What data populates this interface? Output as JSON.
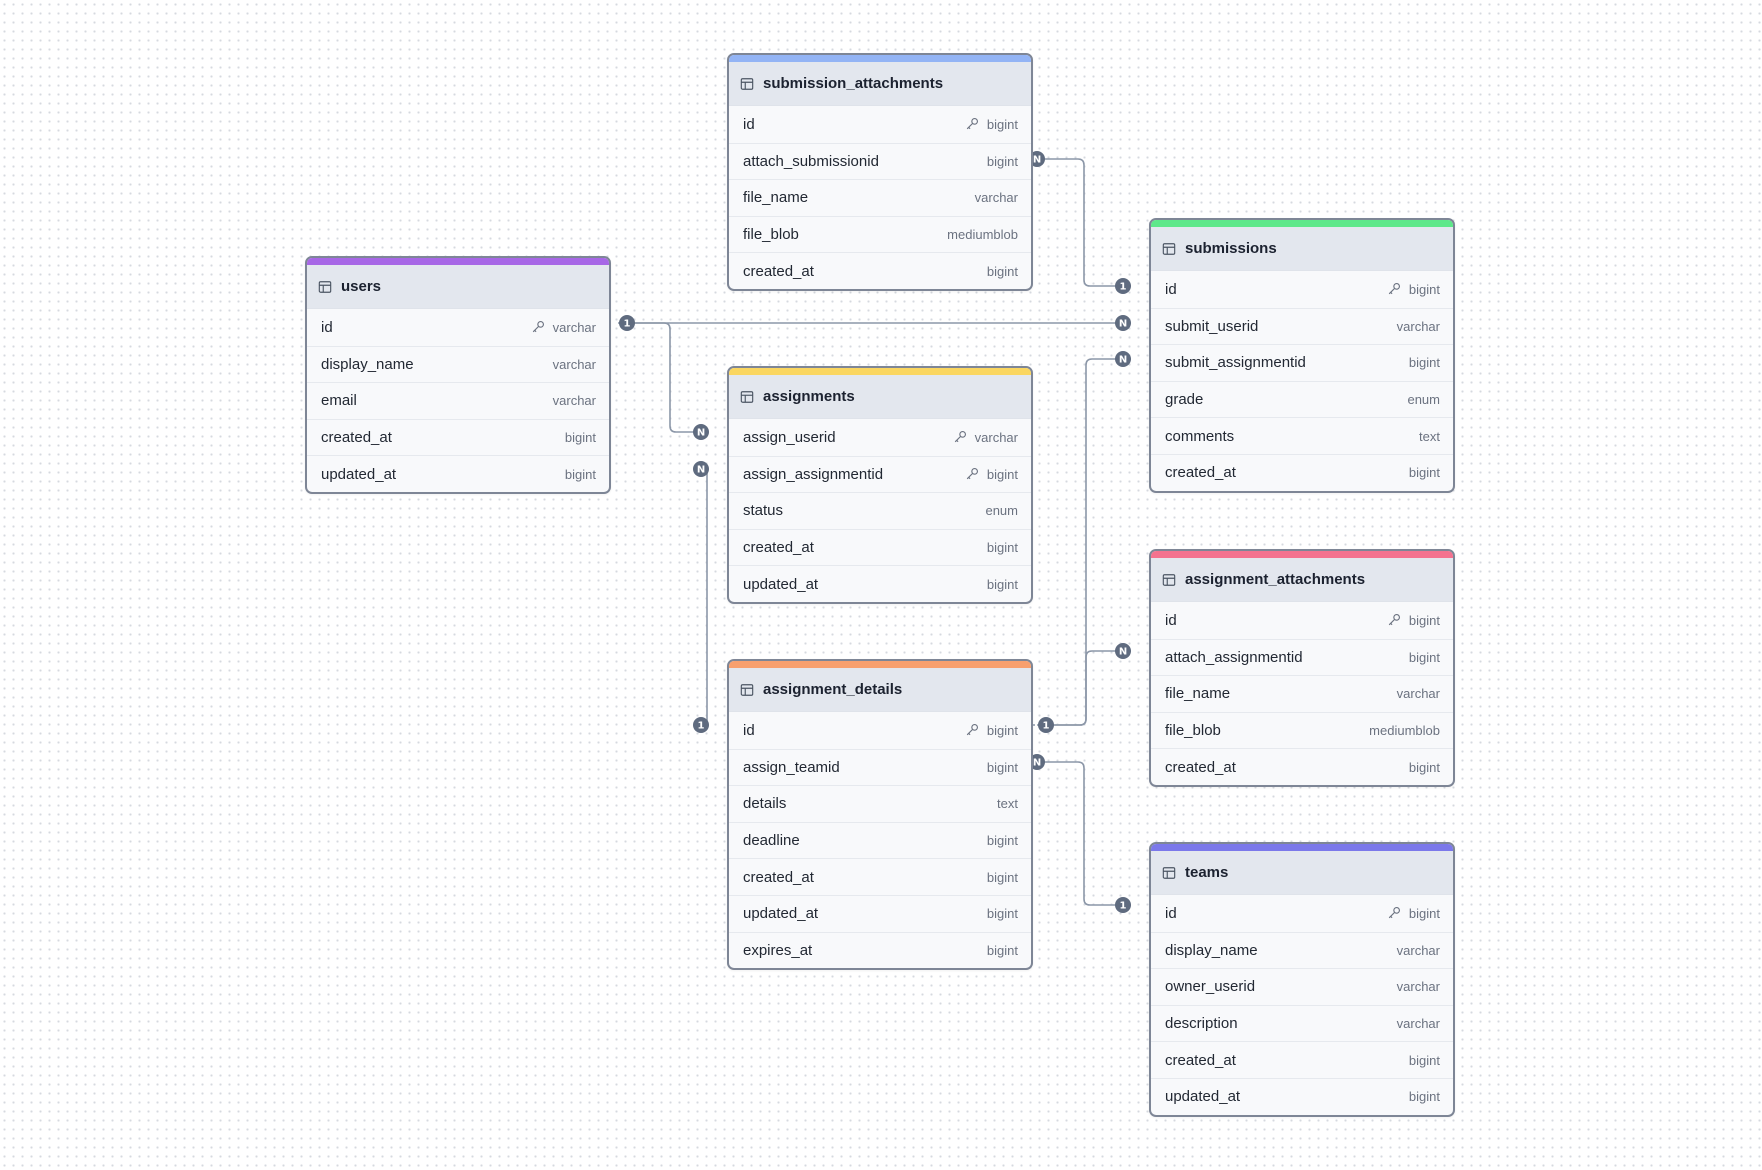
{
  "tables": [
    {
      "id": "submission_attachments",
      "name": "submission_attachments",
      "accent": "#93b4f5",
      "columns": [
        {
          "name": "id",
          "type": "bigint",
          "pk": true
        },
        {
          "name": "attach_submissionid",
          "type": "bigint"
        },
        {
          "name": "file_name",
          "type": "varchar"
        },
        {
          "name": "file_blob",
          "type": "mediumblob"
        },
        {
          "name": "created_at",
          "type": "bigint"
        }
      ]
    },
    {
      "id": "users",
      "name": "users",
      "accent": "#a767e6",
      "columns": [
        {
          "name": "id",
          "type": "varchar",
          "pk": true
        },
        {
          "name": "display_name",
          "type": "varchar"
        },
        {
          "name": "email",
          "type": "varchar"
        },
        {
          "name": "created_at",
          "type": "bigint"
        },
        {
          "name": "updated_at",
          "type": "bigint"
        }
      ]
    },
    {
      "id": "submissions",
      "name": "submissions",
      "accent": "#5ee88a",
      "columns": [
        {
          "name": "id",
          "type": "bigint",
          "pk": true
        },
        {
          "name": "submit_userid",
          "type": "varchar"
        },
        {
          "name": "submit_assignmentid",
          "type": "bigint"
        },
        {
          "name": "grade",
          "type": "enum"
        },
        {
          "name": "comments",
          "type": "text"
        },
        {
          "name": "created_at",
          "type": "bigint"
        }
      ]
    },
    {
      "id": "assignments",
      "name": "assignments",
      "accent": "#fad660",
      "columns": [
        {
          "name": "assign_userid",
          "type": "varchar",
          "pk": true
        },
        {
          "name": "assign_assignmentid",
          "type": "bigint",
          "pk": true
        },
        {
          "name": "status",
          "type": "enum"
        },
        {
          "name": "created_at",
          "type": "bigint"
        },
        {
          "name": "updated_at",
          "type": "bigint"
        }
      ]
    },
    {
      "id": "assignment_attachments",
      "name": "assignment_attachments",
      "accent": "#f4728f",
      "columns": [
        {
          "name": "id",
          "type": "bigint",
          "pk": true
        },
        {
          "name": "attach_assignmentid",
          "type": "bigint"
        },
        {
          "name": "file_name",
          "type": "varchar"
        },
        {
          "name": "file_blob",
          "type": "mediumblob"
        },
        {
          "name": "created_at",
          "type": "bigint"
        }
      ]
    },
    {
      "id": "assignment_details",
      "name": "assignment_details",
      "accent": "#f8a06e",
      "columns": [
        {
          "name": "id",
          "type": "bigint",
          "pk": true
        },
        {
          "name": "assign_teamid",
          "type": "bigint"
        },
        {
          "name": "details",
          "type": "text"
        },
        {
          "name": "deadline",
          "type": "bigint"
        },
        {
          "name": "created_at",
          "type": "bigint"
        },
        {
          "name": "updated_at",
          "type": "bigint"
        },
        {
          "name": "expires_at",
          "type": "bigint"
        }
      ]
    },
    {
      "id": "teams",
      "name": "teams",
      "accent": "#7b78ea",
      "columns": [
        {
          "name": "id",
          "type": "bigint",
          "pk": true
        },
        {
          "name": "display_name",
          "type": "varchar"
        },
        {
          "name": "owner_userid",
          "type": "varchar"
        },
        {
          "name": "description",
          "type": "varchar"
        },
        {
          "name": "created_at",
          "type": "bigint"
        },
        {
          "name": "updated_at",
          "type": "bigint"
        }
      ]
    }
  ],
  "relationships": [
    {
      "from": "submission_attachments.attach_submissionid",
      "from_card": "N",
      "to": "submissions.id",
      "to_card": "1"
    },
    {
      "from": "users.id",
      "from_card": "1",
      "to": "submissions.submit_userid",
      "to_card": "N"
    },
    {
      "from": "users.id",
      "from_card": "1",
      "to": "assignments.assign_userid",
      "to_card": "N"
    },
    {
      "from": "assignment_details.id",
      "from_card": "1",
      "to": "assignments.assign_assignmentid",
      "to_card": "N"
    },
    {
      "from": "assignment_details.id",
      "from_card": "1",
      "to": "submissions.submit_assignmentid",
      "to_card": "N"
    },
    {
      "from": "assignment_details.id",
      "from_card": "1",
      "to": "assignment_attachments.attach_assignmentid",
      "to_card": "N"
    },
    {
      "from": "assignment_details.assign_teamid",
      "from_card": "N",
      "to": "teams.id",
      "to_card": "1"
    }
  ],
  "style": {
    "line_color": "#8c97a8",
    "badge_color": "#5f6b7f"
  }
}
